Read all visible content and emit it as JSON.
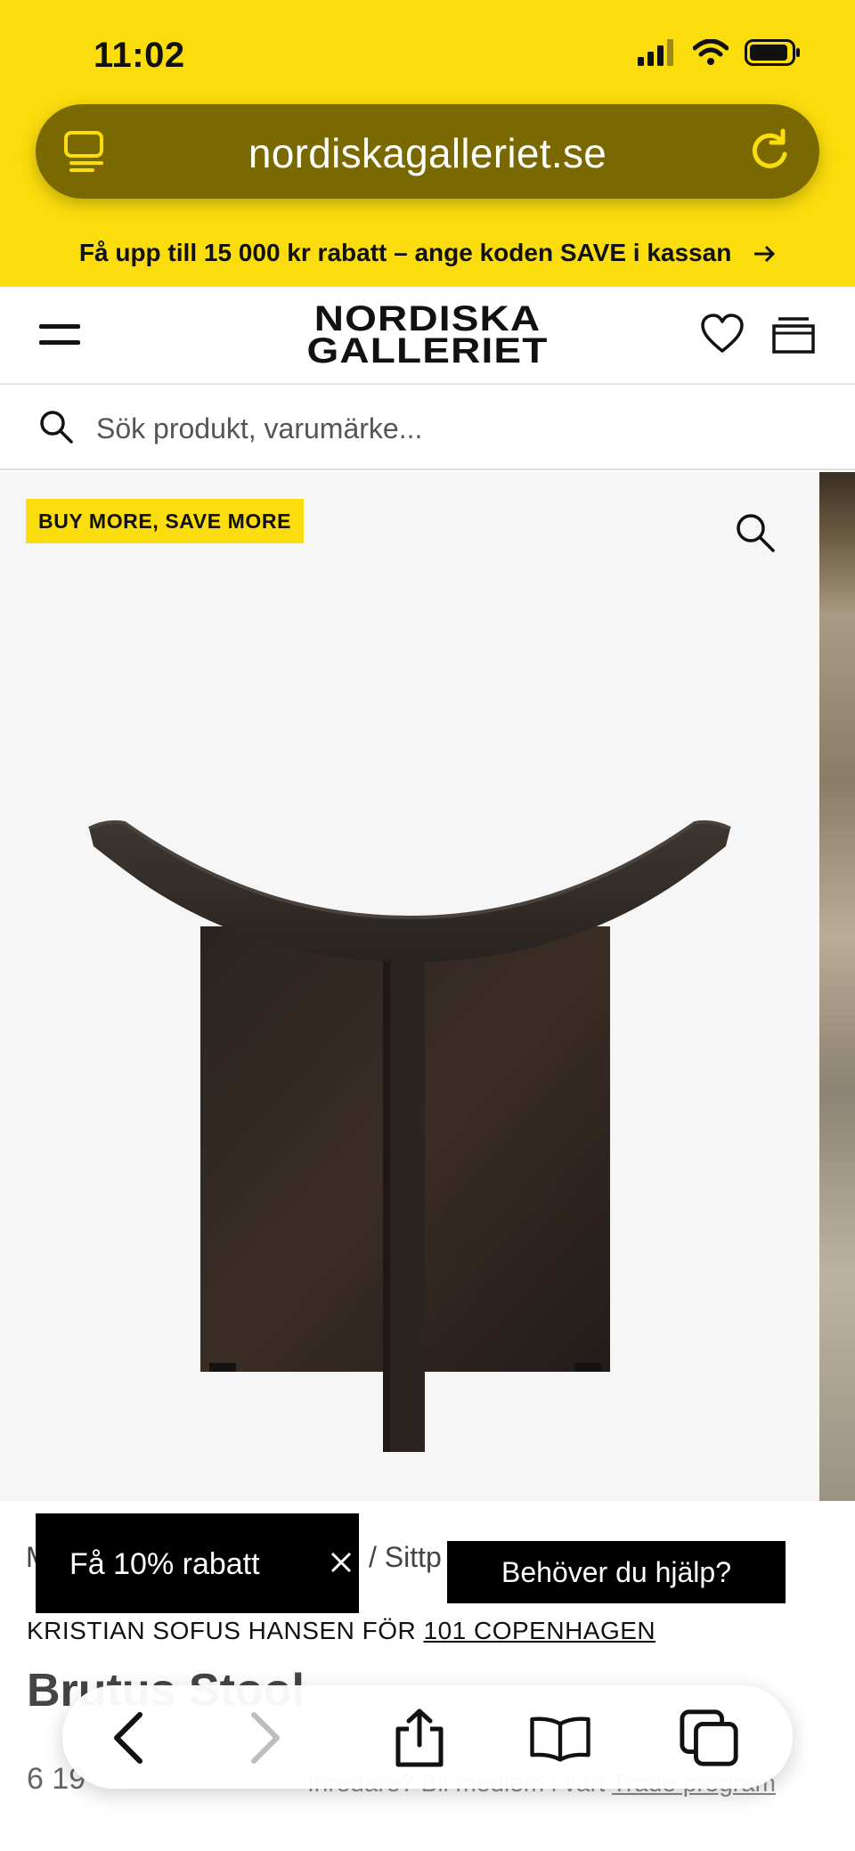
{
  "status_bar": {
    "time": "11:02"
  },
  "browser": {
    "url": "nordiskagalleriet.se"
  },
  "promo": {
    "text": "Få upp till 15 000 kr rabatt – ange koden SAVE i kassan"
  },
  "header": {
    "logo_line1": "NORDISKA",
    "logo_line2": "GALLERIET"
  },
  "search": {
    "placeholder": "Sök produkt, varumärke..."
  },
  "gallery": {
    "badge": "BUY MORE, SAVE MORE"
  },
  "product": {
    "breadcrumb_start": "M",
    "breadcrumb_tail": "/ Sittp",
    "designer_prefix": "KRISTIAN SOFUS HANSEN FÖR",
    "brand": "101 COPENHAGEN",
    "title": "Brutus Stool",
    "price": "6 19",
    "trade_prefix": "Inredare? Bli medlem i vårt",
    "trade_link": "Trade program"
  },
  "popups": {
    "discount": "Få 10% rabatt",
    "help": "Behöver du hjälp?"
  },
  "colors": {
    "brand_yellow": "#fbdd0d",
    "address_bar": "#7a6800",
    "reload_icon": "#fbdd0d"
  }
}
